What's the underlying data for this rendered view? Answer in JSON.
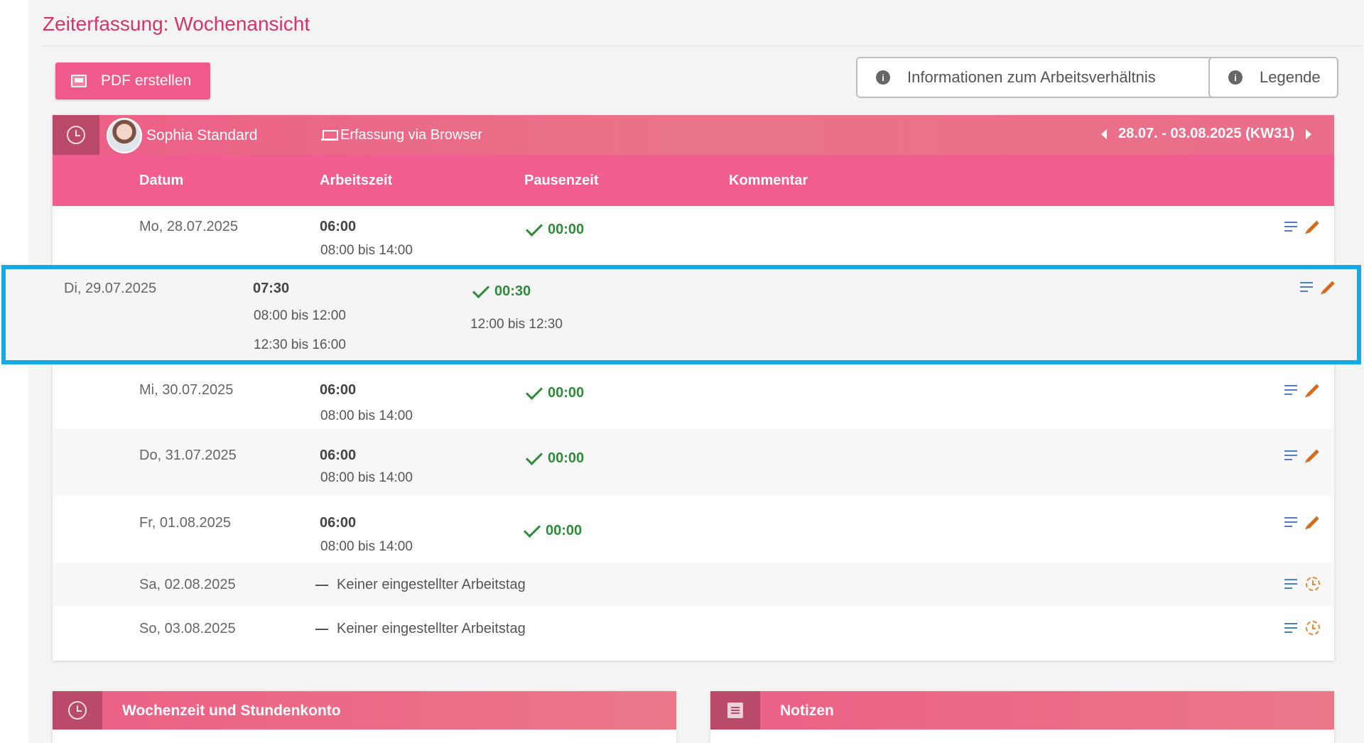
{
  "page": {
    "title": "Zeiterfassung: Wochenansicht"
  },
  "toolbar": {
    "pdf_label": "PDF erstellen",
    "info_label": "Informationen zum Arbeitsverhältnis",
    "legend_label": "Legende"
  },
  "card": {
    "user_name": "Sophia Standard",
    "capture_mode": "Erfassung via Browser",
    "week_range": "28.07. - 03.08.2025 (KW31)"
  },
  "columns": {
    "date": "Datum",
    "work": "Arbeitszeit",
    "pause": "Pausenzeit",
    "comment": "Kommentar"
  },
  "rows": [
    {
      "date": "Mo, 28.07.2025",
      "work": "06:00",
      "ranges": [
        "08:00 bis 14:00"
      ],
      "pause": "00:00"
    },
    {
      "date": "Di, 29.07.2025",
      "work": "07:30",
      "ranges": [
        "08:00 bis 12:00",
        "12:30 bis 16:00"
      ],
      "pause": "00:30",
      "pause_range": "12:00 bis 12:30"
    },
    {
      "date": "Mi, 30.07.2025",
      "work": "06:00",
      "ranges": [
        "08:00 bis 14:00"
      ],
      "pause": "00:00"
    },
    {
      "date": "Do, 31.07.2025",
      "work": "06:00",
      "ranges": [
        "08:00 bis 14:00"
      ],
      "pause": "00:00"
    },
    {
      "date": "Fr, 01.08.2025",
      "work": "06:00",
      "ranges": [
        "08:00 bis 14:00"
      ],
      "pause": "00:00"
    },
    {
      "date": "Sa, 02.08.2025",
      "note": "Keiner eingestellter Arbeitstag"
    },
    {
      "date": "So, 03.08.2025",
      "note": "Keiner eingestellter Arbeitstag"
    }
  ],
  "panels": {
    "weekly": "Wochenzeit und Stundenkonto",
    "notes": "Notizen"
  },
  "colors": {
    "brand_pink": "#f05d8e",
    "title_pink": "#d6336c",
    "highlight_blue": "#15a9e6",
    "check_green": "#2e8b3a"
  },
  "icons": [
    "pdf-icon",
    "info-icon",
    "clock-icon",
    "laptop-icon",
    "chevron-left-icon",
    "chevron-right-icon",
    "check-icon",
    "comment-lines-icon",
    "pencil-icon",
    "clock-small-icon",
    "note-icon"
  ]
}
